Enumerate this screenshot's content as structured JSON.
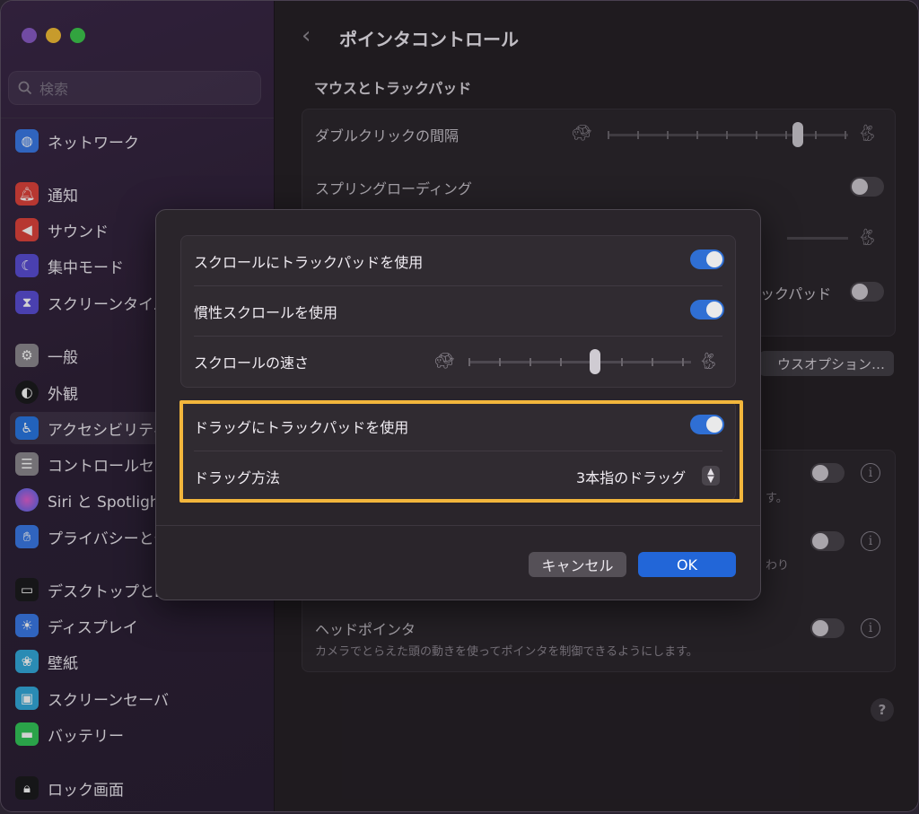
{
  "sidebar": {
    "search_placeholder": "検索",
    "items": [
      {
        "label": "ネットワーク",
        "icon": "globe-icon",
        "color": "#3b7be8"
      },
      {
        "label": "通知",
        "icon": "bell-icon",
        "color": "#e0443c"
      },
      {
        "label": "サウンド",
        "icon": "speaker-icon",
        "color": "#e0443c"
      },
      {
        "label": "集中モード",
        "icon": "moon-icon",
        "color": "#5b4fd6"
      },
      {
        "label": "スクリーンタイム",
        "icon": "hourglass-icon",
        "color": "#5b4fd6"
      },
      {
        "label": "一般",
        "icon": "gear-icon",
        "color": "#8e8a90"
      },
      {
        "label": "外観",
        "icon": "appearance-icon",
        "color": "#1c1c1e"
      },
      {
        "label": "アクセシビリティ",
        "icon": "accessibility-icon",
        "color": "#2a78e4"
      },
      {
        "label": "コントロールセンター",
        "icon": "control-center-icon",
        "color": "#8e8a90"
      },
      {
        "label": "Siri と Spotlight",
        "icon": "siri-icon",
        "color": "#6b4ad6"
      },
      {
        "label": "プライバシーとセキュリティ",
        "icon": "hand-icon",
        "color": "#3b7be8"
      },
      {
        "label": "デスクトップとDock",
        "icon": "dock-icon",
        "color": "#1c1c1e"
      },
      {
        "label": "ディスプレイ",
        "icon": "sun-icon",
        "color": "#3b7be8"
      },
      {
        "label": "壁紙",
        "icon": "flower-icon",
        "color": "#34aadc"
      },
      {
        "label": "スクリーンセーバ",
        "icon": "screensaver-icon",
        "color": "#34aadc"
      },
      {
        "label": "バッテリー",
        "icon": "battery-icon",
        "color": "#34c759"
      },
      {
        "label": "ロック画面",
        "icon": "lock-icon",
        "color": "#1c1c1e"
      }
    ]
  },
  "main": {
    "back_glyph": "‹",
    "title": "ポインタコントロール",
    "section": "マウスとトラックパッド",
    "double_click": "ダブルクリックの間隔",
    "spring_loading": "スプリングローディング",
    "trackpad_partial": "ックパッド",
    "mouse_options_partial": "ウスオプション…",
    "sub_partial_1": "す。",
    "sub_partial_2": "わり",
    "head_pointer": "ヘッドポインタ",
    "head_pointer_desc": "カメラでとらえた頭の動きを使ってポインタを制御できるようにします。",
    "help": "?"
  },
  "dialog": {
    "scroll_trackpad": "スクロールにトラックパッドを使用",
    "inertia_scroll": "慣性スクロールを使用",
    "scroll_speed": "スクロールの速さ",
    "drag_trackpad": "ドラッグにトラックパッドを使用",
    "drag_method": "ドラッグ方法",
    "drag_method_value": "3本指のドラッグ",
    "cancel": "キャンセル",
    "ok": "OK"
  },
  "colors": {
    "accent": "#2266d8",
    "highlight": "#f2b63c"
  }
}
